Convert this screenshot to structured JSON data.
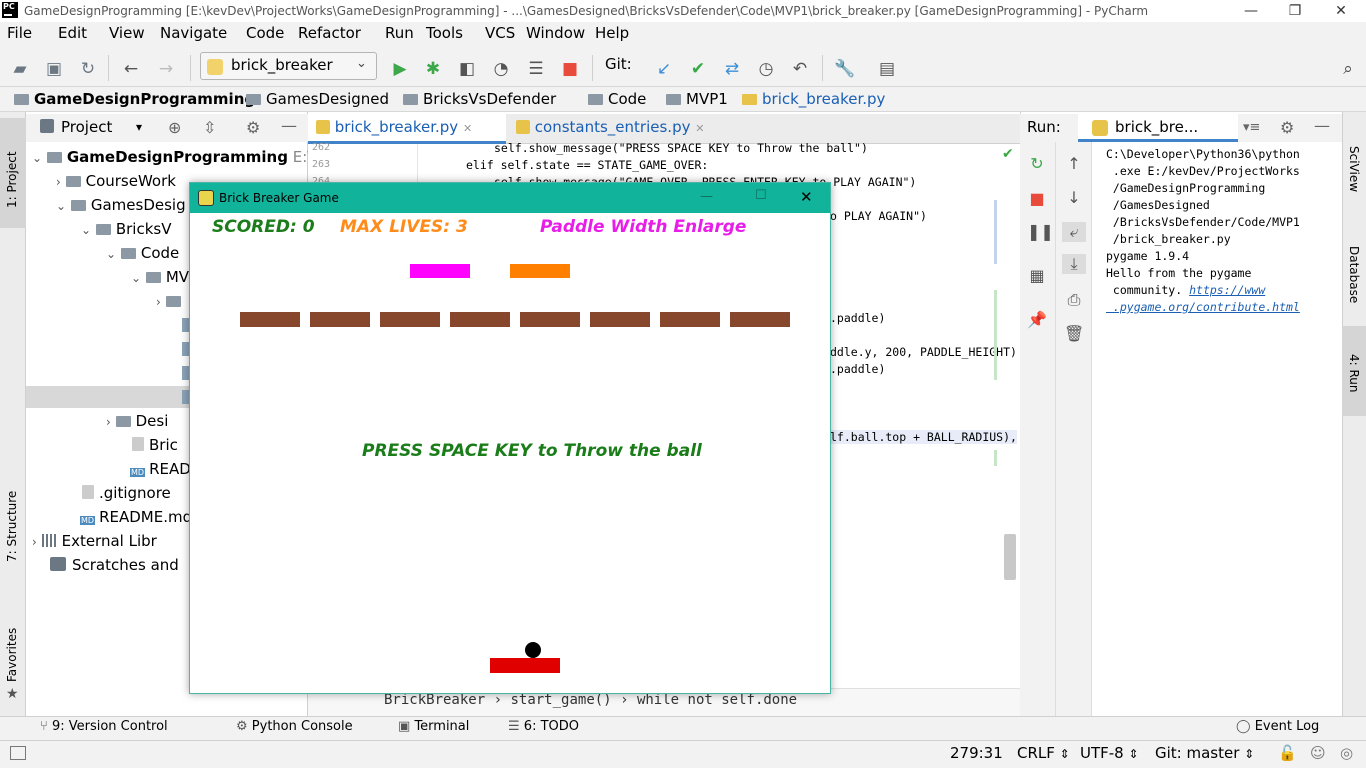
{
  "window": {
    "title": "GameDesignProgramming [E:\\kevDev\\ProjectWorks\\GameDesignProgramming] - ...\\GamesDesigned\\BricksVsDefender\\Code\\MVP1\\brick_breaker.py [GameDesignProgramming] - PyCharm",
    "logo_text": "PC",
    "minimize": "—",
    "restore": "❐",
    "close": "✕"
  },
  "menu": [
    "File",
    "Edit",
    "View",
    "Navigate",
    "Code",
    "Refactor",
    "Run",
    "Tools",
    "VCS",
    "Window",
    "Help"
  ],
  "toolbar": {
    "run_config": "brick_breaker",
    "git_label": "Git:",
    "icons": [
      "open-folder-icon",
      "save-icon",
      "sync-icon",
      "back-icon",
      "forward-icon",
      "run-icon",
      "debug-icon",
      "coverage-icon",
      "profile-icon",
      "concurrency-icon",
      "stop-icon",
      "vcs-update-icon",
      "vcs-commit-icon",
      "vcs-compare-icon",
      "history-icon",
      "revert-icon",
      "settings-icon",
      "project-structure-icon",
      "search-icon"
    ]
  },
  "breadcrumb": [
    "GameDesignProgramming",
    "GamesDesigned",
    "BricksVsDefender",
    "Code",
    "MVP1",
    "brick_breaker.py"
  ],
  "left_strip": {
    "project": "1: Project",
    "structure": "7: Structure",
    "favorites": "Favorites"
  },
  "project_panel": {
    "title": "Project",
    "tree": [
      {
        "label": "GameDesignProgramming",
        "extra": "E:\\"
      },
      {
        "label": "CourseWork"
      },
      {
        "label": "GamesDesig"
      },
      {
        "label": "BricksV"
      },
      {
        "label": "Code"
      },
      {
        "label": "MV"
      },
      {
        "label": "Desi"
      },
      {
        "label": "Bric"
      },
      {
        "label": "READ"
      },
      {
        "label": ".gitignore"
      },
      {
        "label": "README.md"
      },
      {
        "label": "External Libr"
      },
      {
        "label": "Scratches and"
      }
    ],
    "md_badge": "MD"
  },
  "editor": {
    "tabs": [
      "brick_breaker.py",
      "constants_entries.py"
    ],
    "tab_close": "✕",
    "line_numbers": [
      "262",
      "263",
      "264"
    ],
    "lines": [
      "self.show_message(\"PRESS SPACE KEY to Throw the ball\")",
      "elif self.state == STATE_GAME_OVER:",
      "self.show_message(\"GAME OVER  PRESS ENTER KEY to PLAY AGAIN\")",
      "o PLAY AGAIN\")",
      ".paddle)",
      "ddle.y, 200, PADDLE_HEIGHT)",
      ".paddle)",
      "lf.ball.top + BALL_RADIUS),"
    ],
    "footer_breadcrumb": [
      "BrickBreaker",
      "start_game()",
      "while not self.done"
    ],
    "footer_sep": "›"
  },
  "run_panel": {
    "label": "Run:",
    "config": "brick_bre...",
    "output_lines": [
      "C:\\Developer\\Python36\\python",
      " .exe E:/kevDev/ProjectWorks",
      " /GameDesignProgramming",
      " /GamesDesigned",
      " /BricksVsDefender/Code/MVP1",
      " /brick_breaker.py",
      "pygame 1.9.4",
      "Hello from the pygame",
      " community. "
    ],
    "link_lines": [
      "https://www",
      " .pygame.org/contribute.html"
    ]
  },
  "right_strip": {
    "sciview": "SciView",
    "database": "Database",
    "run": "4: Run"
  },
  "bottom_tabs": [
    "9: Version Control",
    "Python Console",
    "Terminal",
    "6: TODO"
  ],
  "event_log": "Event Log",
  "status": {
    "position": "279:31",
    "line_sep": "CRLF",
    "encoding": "UTF-8",
    "git": "Git: master",
    "arrows": "⇕"
  },
  "game": {
    "title": "Brick Breaker Game",
    "minimize": "—",
    "maximize": "☐",
    "close": "✕",
    "score": "SCORED: 0",
    "lives": "MAX LIVES: 3",
    "powerup": "Paddle Width Enlarge",
    "message": "PRESS SPACE KEY to Throw the ball",
    "colors": {
      "score": "#1a7d1a",
      "lives": "#ff8c1a",
      "powerup": "#e81ee8",
      "message": "#1a7d1a",
      "brick": "#87472d",
      "paddle": "#e00000",
      "ball": "#000000",
      "titlebar": "#12b39b"
    },
    "brick_count": 8
  },
  "accent": {
    "link": "#1a5fb4",
    "vcs_blue": "#3d8fd6",
    "vcs_green": "#38a843",
    "stop": "#e84a3c",
    "run": "#3ca84a"
  }
}
